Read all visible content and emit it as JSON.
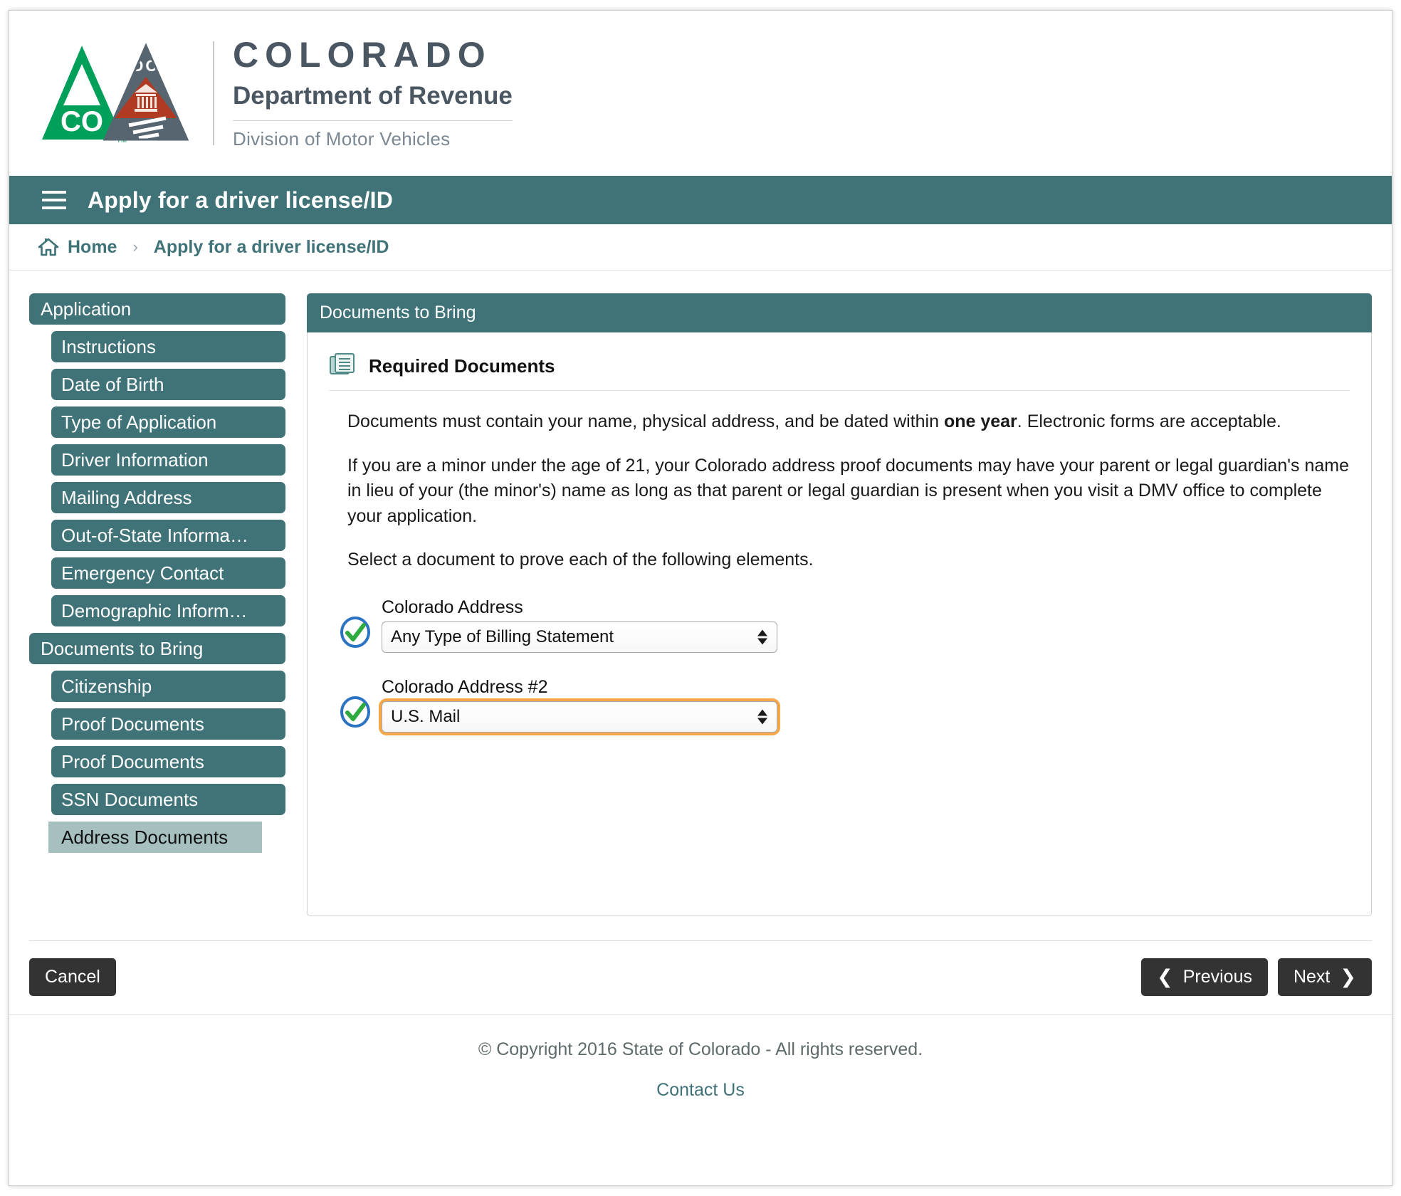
{
  "brand": {
    "state_name": "COLORADO",
    "department": "Department of Revenue",
    "division": "Division of Motor Vehicles",
    "logo_cdor_text": "CDOR",
    "logo_co_text": "CO",
    "logo_tm": "TM",
    "colors": {
      "green": "#00a05a",
      "gray_triangle": "#576570",
      "red_triangle": "#b03a22",
      "teal": "#3f7378",
      "text_gray": "#4a5661"
    }
  },
  "titlebar": {
    "menu_icon": "hamburger-icon",
    "title": "Apply for a driver license/ID"
  },
  "breadcrumb": {
    "home_icon": "home-icon",
    "home_label": "Home",
    "separator": "›",
    "current": "Apply for a driver license/ID"
  },
  "sidebar": {
    "groups": [
      {
        "label": "Application",
        "items": [
          {
            "label": "Instructions",
            "active": false
          },
          {
            "label": "Date of Birth",
            "active": false
          },
          {
            "label": "Type of Application",
            "active": false
          },
          {
            "label": "Driver Information",
            "active": false
          },
          {
            "label": "Mailing Address",
            "active": false
          },
          {
            "label": "Out-of-State Informa…",
            "active": false
          },
          {
            "label": "Emergency Contact",
            "active": false
          },
          {
            "label": "Demographic Inform…",
            "active": false
          }
        ]
      },
      {
        "label": "Documents to Bring",
        "items": [
          {
            "label": "Citizenship",
            "active": false
          },
          {
            "label": "Proof Documents",
            "active": false
          },
          {
            "label": "Proof Documents",
            "active": false
          },
          {
            "label": "SSN Documents",
            "active": false
          },
          {
            "label": "Address Documents",
            "active": true
          }
        ]
      }
    ]
  },
  "panel": {
    "header": "Documents to Bring",
    "section_icon": "documents-icon",
    "section_title": "Required Documents",
    "paragraphs": {
      "p1_before": "Documents must contain your name, physical address, and be dated within ",
      "p1_bold": "one year",
      "p1_after": ". Electronic forms are acceptable.",
      "p2": "If you are a minor under the age of 21, your Colorado address proof documents may have your parent or legal guardian's name in lieu of your (the minor's) name as long as that parent or legal guardian is present when you visit a DMV office to complete your application.",
      "p3": "Select a document to prove each of the following elements."
    },
    "fields": [
      {
        "status_icon": "green-check-icon",
        "label": "Colorado Address",
        "value": "Any Type of Billing Statement",
        "focused": false
      },
      {
        "status_icon": "green-check-icon",
        "label": "Colorado Address #2",
        "value": "U.S. Mail",
        "focused": true
      }
    ]
  },
  "actions": {
    "cancel": "Cancel",
    "previous": "Previous",
    "next": "Next",
    "prev_icon": "❮",
    "next_icon": "❯"
  },
  "footer": {
    "copyright": "© Copyright 2016 State of Colorado - All rights reserved.",
    "contact": "Contact Us"
  }
}
